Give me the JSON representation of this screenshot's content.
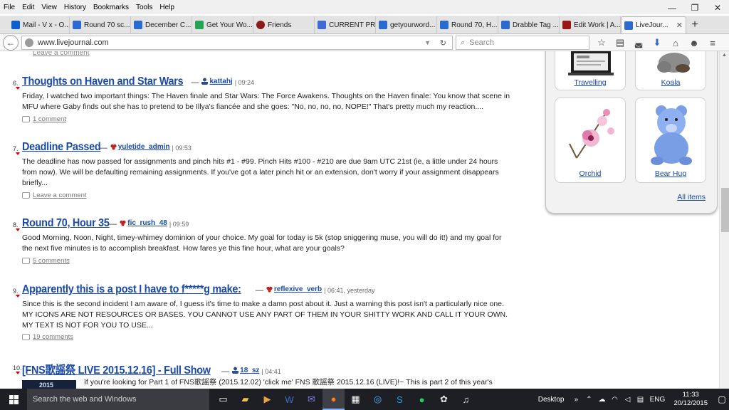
{
  "menubar": {
    "items": [
      "File",
      "Edit",
      "View",
      "History",
      "Bookmarks",
      "Tools",
      "Help"
    ]
  },
  "window_controls": {
    "minimize": "—",
    "restore": "❐",
    "close": "✕"
  },
  "tabs": [
    {
      "label": "Mail - V x - O...",
      "color": "#0b5fd0"
    },
    {
      "label": "Round 70 sc...",
      "color": "#2a6ad1"
    },
    {
      "label": "December C...",
      "color": "#2a6ad1"
    },
    {
      "label": "Get Your Wo...",
      "color": "#23a455"
    },
    {
      "label": "Friends",
      "color": "#8b1a1a"
    },
    {
      "label": "CURRENT PR...",
      "color": "#3f6ad8"
    },
    {
      "label": "getyourword...",
      "color": "#2a6ad1"
    },
    {
      "label": "Round 70, H...",
      "color": "#2a6ad1"
    },
    {
      "label": "Drabble Tag ...",
      "color": "#2a6ad1"
    },
    {
      "label": "Edit Work | A...",
      "color": "#9c1616"
    },
    {
      "label": "LiveJour...",
      "color": "#2a6ad1",
      "active": true
    }
  ],
  "nav": {
    "url": "www.livejournal.com",
    "search_placeholder": "Search"
  },
  "feed": {
    "prev_comment_link": "Leave a comment",
    "posts": [
      {
        "num": "6.",
        "title": "Thoughts on Haven and Star Wars",
        "user": "kattahj",
        "user_type": "person",
        "time": "| 09:24",
        "body": "Friday, I watched two important things: The Haven finale and Star Wars: The Force Awakens. Thoughts on the Haven finale: You know that scene in MFU where Gaby finds out she has to pretend to be Illya's fiancée and she goes: \"No, no, no, no, NOPE!\" That's pretty much my reaction....",
        "comments": "1 comment"
      },
      {
        "num": "7.",
        "title": "Deadline Passed",
        "user": "yuletide_admin",
        "user_type": "comm",
        "time": "| 09:53",
        "body": "The deadline has now passed for assignments and pinch hits #1 - #99. Pinch Hits #100 - #210 are due 9am UTC 21st (ie, a little under 24 hours from now). We will be defaulting remaining assignments. If you've got a later pinch hit or an extension, don't worry if your assignment disappears briefly...",
        "comments": "Leave a comment"
      },
      {
        "num": "8.",
        "title": "Round 70, Hour 35",
        "user": "fic_rush_48",
        "user_type": "comm",
        "time": "| 09:59",
        "body": "Good Morning, Noon, Night, timey-whimey dominion of your choice. My goal for today is 5k (stop sniggering muse, you will do it!) and my goal for the next five minutes is to accomplish breakfast. How fares ye this fine hour, what are your goals?",
        "comments": "5 comments"
      },
      {
        "num": "9.",
        "title": "Apparently this is a post I have to f*****g make:",
        "user": "reflexive_verb",
        "user_type": "comm",
        "time": "| 06:41, yesterday",
        "body": "Since this is the second incident I am aware of, I guess it's time to make a damn post about it. Just a warning this post isn't a particularly nice one. MY ICONS ARE NOT RESOURCES OR BASES. YOU CANNOT USE ANY PART OF THEM IN YOUR SHITTY WORK AND CALL IT YOUR OWN. MY TEXT IS NOT FOR YOU TO USE...",
        "comments": "19 comments"
      },
      {
        "num": "10.",
        "title": "[FNS歌謡祭 LIVE 2015.12.16] - Full Show",
        "user": "18_sz",
        "user_type": "person",
        "time": "| 04:41",
        "body": "If you're looking for Part 1 of FNS歌謡祭 (2015.12.02) 'click me' FNS 歌謡祭 2015.12.16 (LIVE)!~ This is part 2 of this year's",
        "thumb_text": "2015"
      }
    ]
  },
  "gifts": {
    "items": [
      {
        "label": "Travelling"
      },
      {
        "label": "Koala"
      },
      {
        "label": "Orchid"
      },
      {
        "label": "Bear Hug"
      }
    ],
    "all_items": "All items"
  },
  "taskbar": {
    "search_placeholder": "Search the web and Windows",
    "desktop_label": "Desktop",
    "lang": "ENG",
    "time": "11:33",
    "date": "20/12/2015"
  }
}
